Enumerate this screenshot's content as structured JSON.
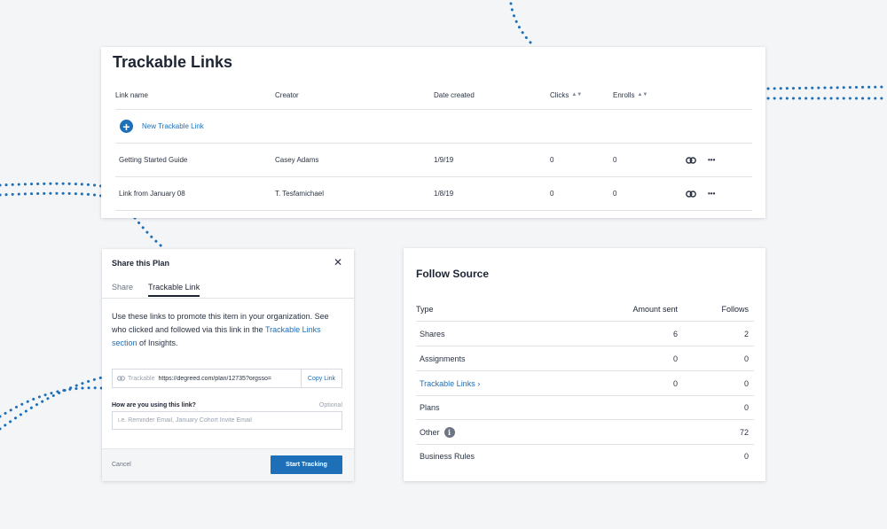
{
  "colors": {
    "accent": "#1d6fb8",
    "text": "#1d2433",
    "background": "#f4f5f7"
  },
  "trackable_links": {
    "title": "Trackable Links",
    "columns": {
      "link_name": "Link name",
      "creator": "Creator",
      "date_created": "Date created",
      "clicks": "Clicks",
      "enrolls": "Enrolls"
    },
    "new_link_label": "New Trackable Link",
    "rows": [
      {
        "name": "Getting Started Guide",
        "creator": "Casey Adams",
        "date": "1/9/19",
        "clicks": "0",
        "enrolls": "0"
      },
      {
        "name": "Link from January 08",
        "creator": "T. Tesfamichael",
        "date": "1/8/19",
        "clicks": "0",
        "enrolls": "0"
      }
    ]
  },
  "share_plan": {
    "title": "Share this Plan",
    "tabs": {
      "share": "Share",
      "trackable": "Trackable Link"
    },
    "description_pre": "Use these links to promote this item in your organization. See who clicked and followed via this link in the ",
    "description_link": "Trackable Links section",
    "description_post": " of Insights.",
    "url_prefix": "Trackable",
    "url": "https://degreed.com/plan/12735?orgsso=",
    "copy_label": "Copy Link",
    "purpose_label": "How are you using this link?",
    "optional_label": "Optional",
    "purpose_placeholder": "i.e. Reminder Email, January Cohort Invite Email",
    "cancel_label": "Cancel",
    "start_label": "Start Tracking"
  },
  "follow_source": {
    "title": "Follow Source",
    "columns": {
      "type": "Type",
      "amount": "Amount sent",
      "follows": "Follows"
    },
    "rows": [
      {
        "type": "Shares",
        "amount": "6",
        "follows": "2"
      },
      {
        "type": "Assignments",
        "amount": "0",
        "follows": "0"
      },
      {
        "type": "Trackable Links ›",
        "amount": "0",
        "follows": "0"
      },
      {
        "type": "Plans",
        "amount": "",
        "follows": "0"
      },
      {
        "type": "Other",
        "amount": "",
        "follows": "72"
      },
      {
        "type": "Business Rules",
        "amount": "",
        "follows": "0"
      }
    ]
  }
}
